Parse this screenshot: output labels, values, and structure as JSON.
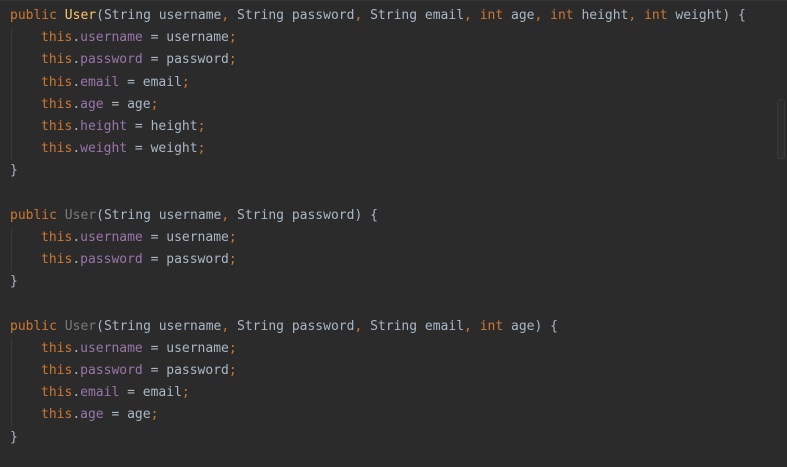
{
  "editor": {
    "constructors": [
      {
        "modifier": "public",
        "name": "User",
        "open_paren": "(",
        "params": [
          {
            "type": "String",
            "name": "username"
          },
          {
            "type": "String",
            "name": "password"
          },
          {
            "type": "String",
            "name": "email"
          },
          {
            "type": "int",
            "name": "age"
          },
          {
            "type": "int",
            "name": "height"
          },
          {
            "type": "int",
            "name": "weight"
          }
        ],
        "close": ") {",
        "body": [
          {
            "this": "this",
            "field": "username",
            "op": " = ",
            "value": "username",
            "semi": ";"
          },
          {
            "this": "this",
            "field": "password",
            "op": " = ",
            "value": "password",
            "semi": ";"
          },
          {
            "this": "this",
            "field": "email",
            "op": " = ",
            "value": "email",
            "semi": ";"
          },
          {
            "this": "this",
            "field": "age",
            "op": " = ",
            "value": "age",
            "semi": ";"
          },
          {
            "this": "this",
            "field": "height",
            "op": " = ",
            "value": "height",
            "semi": ";"
          },
          {
            "this": "this",
            "field": "weight",
            "op": " = ",
            "value": "weight",
            "semi": ";"
          }
        ],
        "end": "}"
      },
      {
        "modifier": "public",
        "name": "User",
        "open_paren": "(",
        "params": [
          {
            "type": "String",
            "name": "username"
          },
          {
            "type": "String",
            "name": "password"
          }
        ],
        "close": ") {",
        "body": [
          {
            "this": "this",
            "field": "username",
            "op": " = ",
            "value": "username",
            "semi": ";"
          },
          {
            "this": "this",
            "field": "password",
            "op": " = ",
            "value": "password",
            "semi": ";"
          }
        ],
        "end": "}"
      },
      {
        "modifier": "public",
        "name": "User",
        "open_paren": "(",
        "params": [
          {
            "type": "String",
            "name": "username"
          },
          {
            "type": "String",
            "name": "password"
          },
          {
            "type": "String",
            "name": "email"
          },
          {
            "type": "int",
            "name": "age"
          }
        ],
        "close": ") {",
        "body": [
          {
            "this": "this",
            "field": "username",
            "op": " = ",
            "value": "username",
            "semi": ";"
          },
          {
            "this": "this",
            "field": "password",
            "op": " = ",
            "value": "password",
            "semi": ";"
          },
          {
            "this": "this",
            "field": "email",
            "op": " = ",
            "value": "email",
            "semi": ";"
          },
          {
            "this": "this",
            "field": "age",
            "op": " = ",
            "value": "age",
            "semi": ";"
          }
        ],
        "end": "}"
      }
    ],
    "colors": {
      "background": "#2b2b2b",
      "keyword": "#cc7832",
      "method_name": "#ffc66d",
      "unused_method_name": "#7a7a7a",
      "field": "#9876aa",
      "text": "#a9b7c6"
    }
  }
}
